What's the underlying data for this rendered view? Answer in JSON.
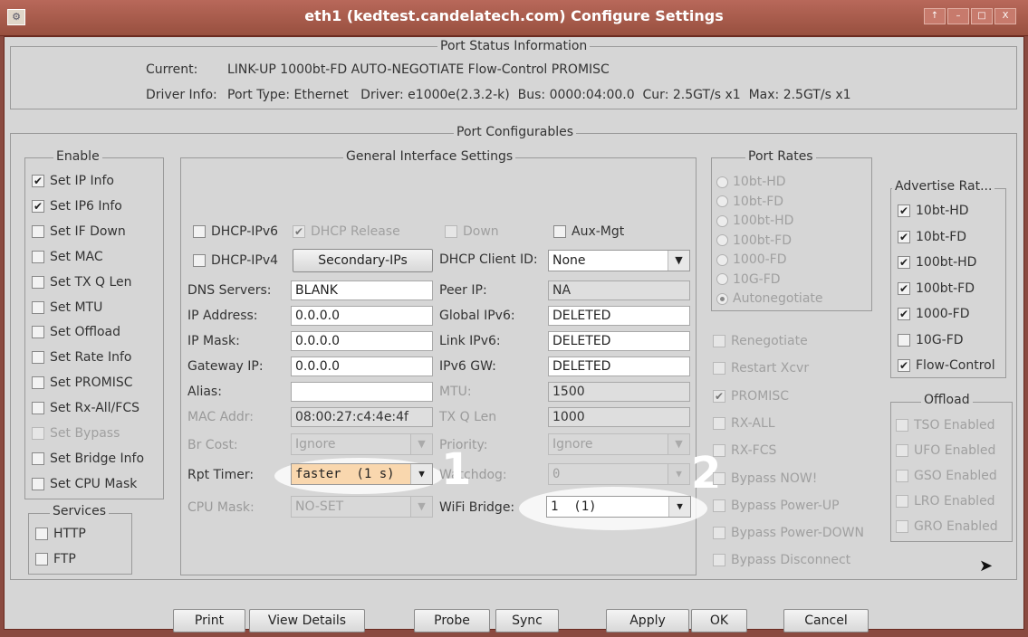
{
  "window": {
    "title": "eth1  (kedtest.candelatech.com) Configure Settings",
    "app_icon": "gear-icon",
    "controls": [
      "↑",
      "–",
      "□",
      "X"
    ]
  },
  "status": {
    "title": "Port Status Information",
    "current_label": "Current:",
    "current_value": "LINK-UP 1000bt-FD AUTO-NEGOTIATE Flow-Control PROMISC",
    "driver_label": "Driver Info:",
    "driver_value": "Port Type: Ethernet   Driver: e1000e(2.3.2-k)  Bus: 0000:04:00.0  Cur: 2.5GT/s x1  Max: 2.5GT/s x1"
  },
  "configurables_title": "Port Configurables",
  "enable": {
    "title": "Enable",
    "items": [
      {
        "label": "Set IP Info",
        "checked": true,
        "disabled": false
      },
      {
        "label": "Set IP6 Info",
        "checked": true,
        "disabled": false
      },
      {
        "label": "Set IF Down",
        "checked": false,
        "disabled": false
      },
      {
        "label": "Set MAC",
        "checked": false,
        "disabled": false
      },
      {
        "label": "Set TX Q Len",
        "checked": false,
        "disabled": false
      },
      {
        "label": "Set MTU",
        "checked": false,
        "disabled": false
      },
      {
        "label": "Set Offload",
        "checked": false,
        "disabled": false
      },
      {
        "label": "Set Rate Info",
        "checked": false,
        "disabled": false
      },
      {
        "label": "Set PROMISC",
        "checked": false,
        "disabled": false
      },
      {
        "label": "Set Rx-All/FCS",
        "checked": false,
        "disabled": false
      },
      {
        "label": "Set Bypass",
        "checked": false,
        "disabled": true
      },
      {
        "label": "Set Bridge Info",
        "checked": false,
        "disabled": false
      },
      {
        "label": "Set CPU Mask",
        "checked": false,
        "disabled": false
      }
    ]
  },
  "services": {
    "title": "Services",
    "items": [
      {
        "label": "HTTP",
        "checked": false
      },
      {
        "label": "FTP",
        "checked": false
      }
    ]
  },
  "general": {
    "title": "General Interface Settings",
    "dhcp_ipv6": "DHCP-IPv6",
    "dhcp_release": "DHCP Release",
    "down": "Down",
    "aux_mgt": "Aux-Mgt",
    "dhcp_ipv4": "DHCP-IPv4",
    "secondary_ips": "Secondary-IPs",
    "dhcp_client_id_label": "DHCP Client ID:",
    "dhcp_client_id": "None",
    "dns_label": "DNS Servers:",
    "dns": "BLANK",
    "peer_ip_label": "Peer IP:",
    "peer_ip": "NA",
    "ip_label": "IP Address:",
    "ip": "0.0.0.0",
    "global_ipv6_label": "Global IPv6:",
    "global_ipv6": "DELETED",
    "mask_label": "IP Mask:",
    "mask": "0.0.0.0",
    "link_ipv6_label": "Link IPv6:",
    "link_ipv6": "DELETED",
    "gw_label": "Gateway IP:",
    "gw": "0.0.0.0",
    "ipv6_gw_label": "IPv6 GW:",
    "ipv6_gw": "DELETED",
    "alias_label": "Alias:",
    "alias": "",
    "mtu_label": "MTU:",
    "mtu": "1500",
    "mac_label": "MAC Addr:",
    "mac": "08:00:27:c4:4e:4f",
    "txq_label": "TX Q Len",
    "txq": "1000",
    "br_cost_label": "Br Cost:",
    "br_cost": "Ignore",
    "priority_label": "Priority:",
    "priority": "Ignore",
    "rpt_timer_label": "Rpt Timer:",
    "rpt_timer": "faster  (1 s)",
    "watchdog_label": "Watchdog:",
    "watchdog": "0",
    "cpu_mask_label": "CPU Mask:",
    "cpu_mask": "NO-SET",
    "wifi_bridge_label": "WiFi Bridge:",
    "wifi_bridge": "1  (1)"
  },
  "port_rates": {
    "title": "Port Rates",
    "items": [
      {
        "label": "10bt-HD",
        "selected": false
      },
      {
        "label": "10bt-FD",
        "selected": false
      },
      {
        "label": "100bt-HD",
        "selected": false
      },
      {
        "label": "100bt-FD",
        "selected": false
      },
      {
        "label": "1000-FD",
        "selected": false
      },
      {
        "label": "10G-FD",
        "selected": false
      },
      {
        "label": "Autonegotiate",
        "selected": true
      }
    ]
  },
  "options": [
    {
      "label": "Renegotiate",
      "checked": false
    },
    {
      "label": "Restart Xcvr",
      "checked": false
    },
    {
      "label": "PROMISC",
      "checked": true
    },
    {
      "label": "RX-ALL",
      "checked": false
    },
    {
      "label": "RX-FCS",
      "checked": false
    },
    {
      "label": "Bypass NOW!",
      "checked": false
    },
    {
      "label": "Bypass Power-UP",
      "checked": false
    },
    {
      "label": "Bypass Power-DOWN",
      "checked": false
    },
    {
      "label": "Bypass Disconnect",
      "checked": false
    }
  ],
  "advertise": {
    "title": "Advertise Rat...",
    "items": [
      {
        "label": "10bt-HD",
        "checked": true
      },
      {
        "label": "10bt-FD",
        "checked": true
      },
      {
        "label": "100bt-HD",
        "checked": true
      },
      {
        "label": "100bt-FD",
        "checked": true
      },
      {
        "label": "1000-FD",
        "checked": true
      },
      {
        "label": "10G-FD",
        "checked": false
      },
      {
        "label": "Flow-Control",
        "checked": true
      }
    ]
  },
  "offload": {
    "title": "Offload",
    "items": [
      {
        "label": "TSO Enabled",
        "checked": false
      },
      {
        "label": "UFO Enabled",
        "checked": false
      },
      {
        "label": "GSO Enabled",
        "checked": false
      },
      {
        "label": "LRO Enabled",
        "checked": false
      },
      {
        "label": "GRO Enabled",
        "checked": false
      }
    ]
  },
  "annotations": [
    "1",
    "2"
  ],
  "buttons": {
    "print": "Print",
    "view_details": "View Details",
    "probe": "Probe",
    "sync": "Sync",
    "apply": "Apply",
    "ok": "OK",
    "cancel": "Cancel"
  }
}
